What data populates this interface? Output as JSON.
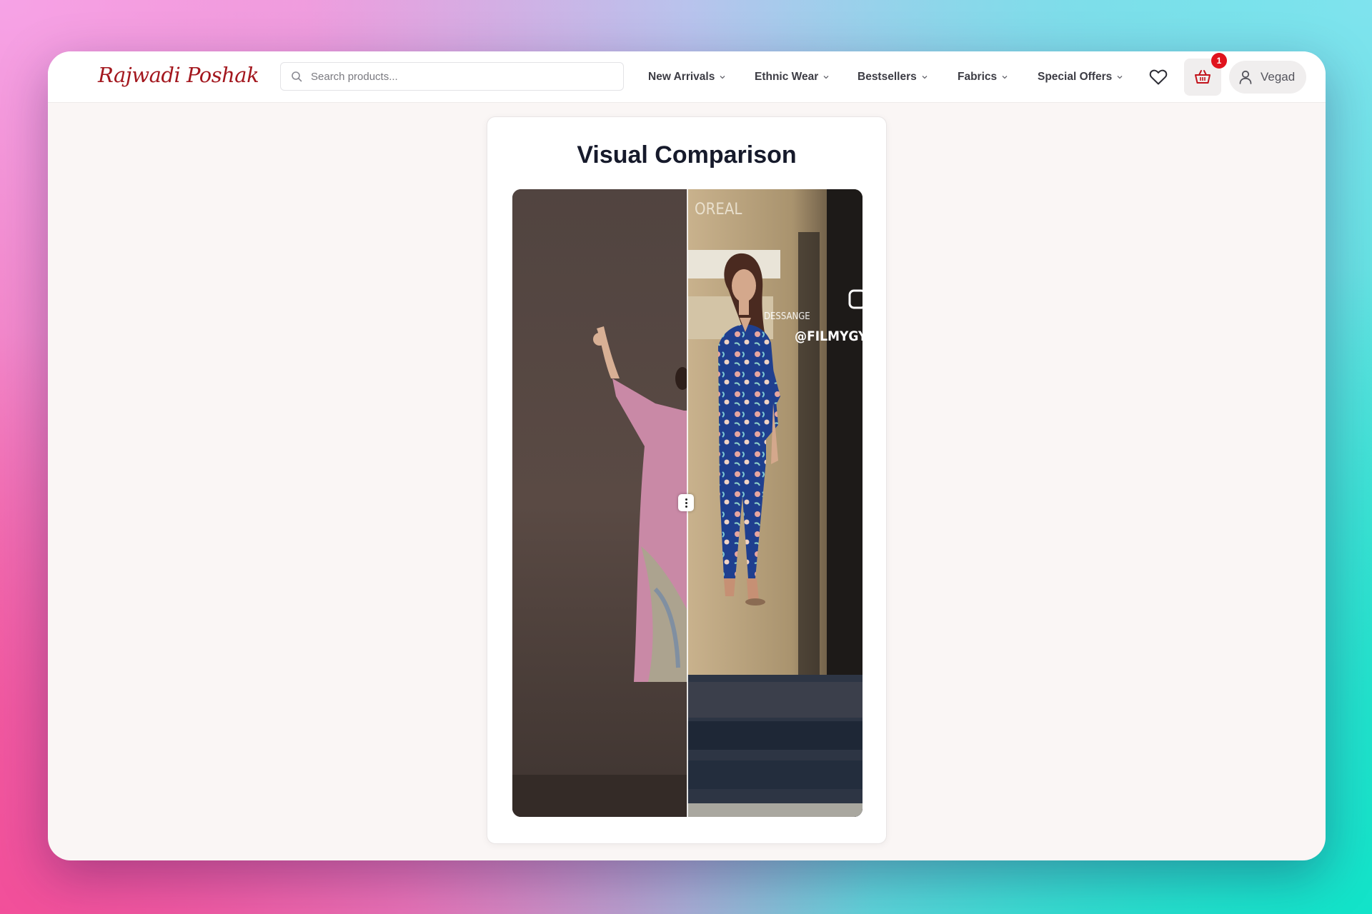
{
  "brand": {
    "logo_text": "Rajwadi Poshak"
  },
  "search": {
    "placeholder": "Search products..."
  },
  "nav": {
    "items": [
      {
        "label": "New Arrivals"
      },
      {
        "label": "Ethnic Wear"
      },
      {
        "label": "Bestsellers"
      },
      {
        "label": "Fabrics"
      },
      {
        "label": "Special Offers"
      }
    ]
  },
  "header_actions": {
    "wishlist_icon": "heart-icon",
    "cart_icon": "basket-icon",
    "cart_count": "1",
    "user_icon": "user-icon",
    "user_name": "Vegad"
  },
  "main": {
    "title": "Visual Comparison",
    "comparison": {
      "split_fraction": 0.5,
      "left_image": "woman in pink floral kurta leaning on brown wall",
      "right_image": "woman in blue floral co-ord set stepping out of a salon",
      "watermark_text": "@FILMYGYA",
      "sign_text": "DESSANGE",
      "store_sign_text": "OREAL"
    }
  },
  "colors": {
    "brand": "#a3171e",
    "badge": "#e0131d",
    "title": "#161a2b",
    "page_bg": "#faf6f5"
  }
}
